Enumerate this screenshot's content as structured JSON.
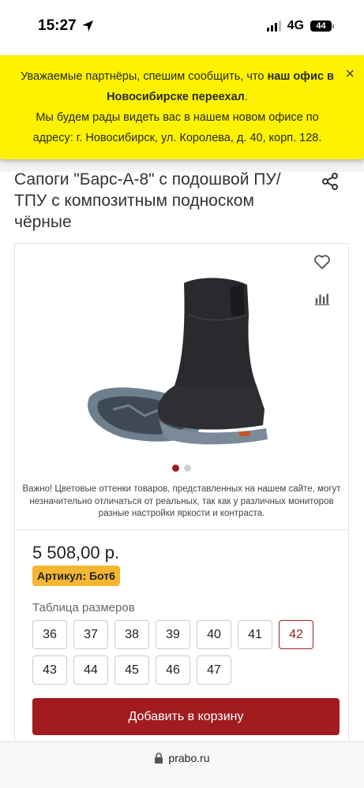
{
  "status_bar": {
    "time": "15:27",
    "network": "4G",
    "battery": "44"
  },
  "banner": {
    "text_1": "Уважаемые партнёры, спешим сообщить, что ",
    "text_bold": "наш офис в Новосибирске переехал",
    "text_2": ".",
    "text_3": "Мы будем рады видеть вас в нашем новом офисе по адресу: г. Новосибирск, ул. Королева, д. 40, корп. 128.",
    "close": "×"
  },
  "product": {
    "title": "Сапоги \"Барс-А-8\" с подошвой ПУ/ТПУ с композитным подноском чёрные",
    "disclaimer": "Важно! Цветовые оттенки товаров, представленных на нашем сайте, могут незначительно отличаться от реальных, так как у различных мониторов разные настройки яркости и контраста.",
    "price": "5 508,00 р.",
    "sku": "Артикул: Бот6",
    "sizes_label": "Таблица размеров",
    "sizes": [
      "36",
      "37",
      "38",
      "39",
      "40",
      "41",
      "42",
      "43",
      "44",
      "45",
      "46",
      "47"
    ],
    "selected_size": "42",
    "cart_button": "Добавить в корзину",
    "gallery_slides": 2,
    "active_slide": 1
  },
  "icons": {
    "share": "share-icon",
    "favorite": "heart-icon",
    "compare": "bar-chart-icon",
    "lock": "lock-icon",
    "location": "location-arrow-icon"
  },
  "colors": {
    "banner": "#fff200",
    "accent": "#a01c1e",
    "sku_badge": "#f5b731"
  },
  "browser": {
    "url": "prabo.ru"
  }
}
